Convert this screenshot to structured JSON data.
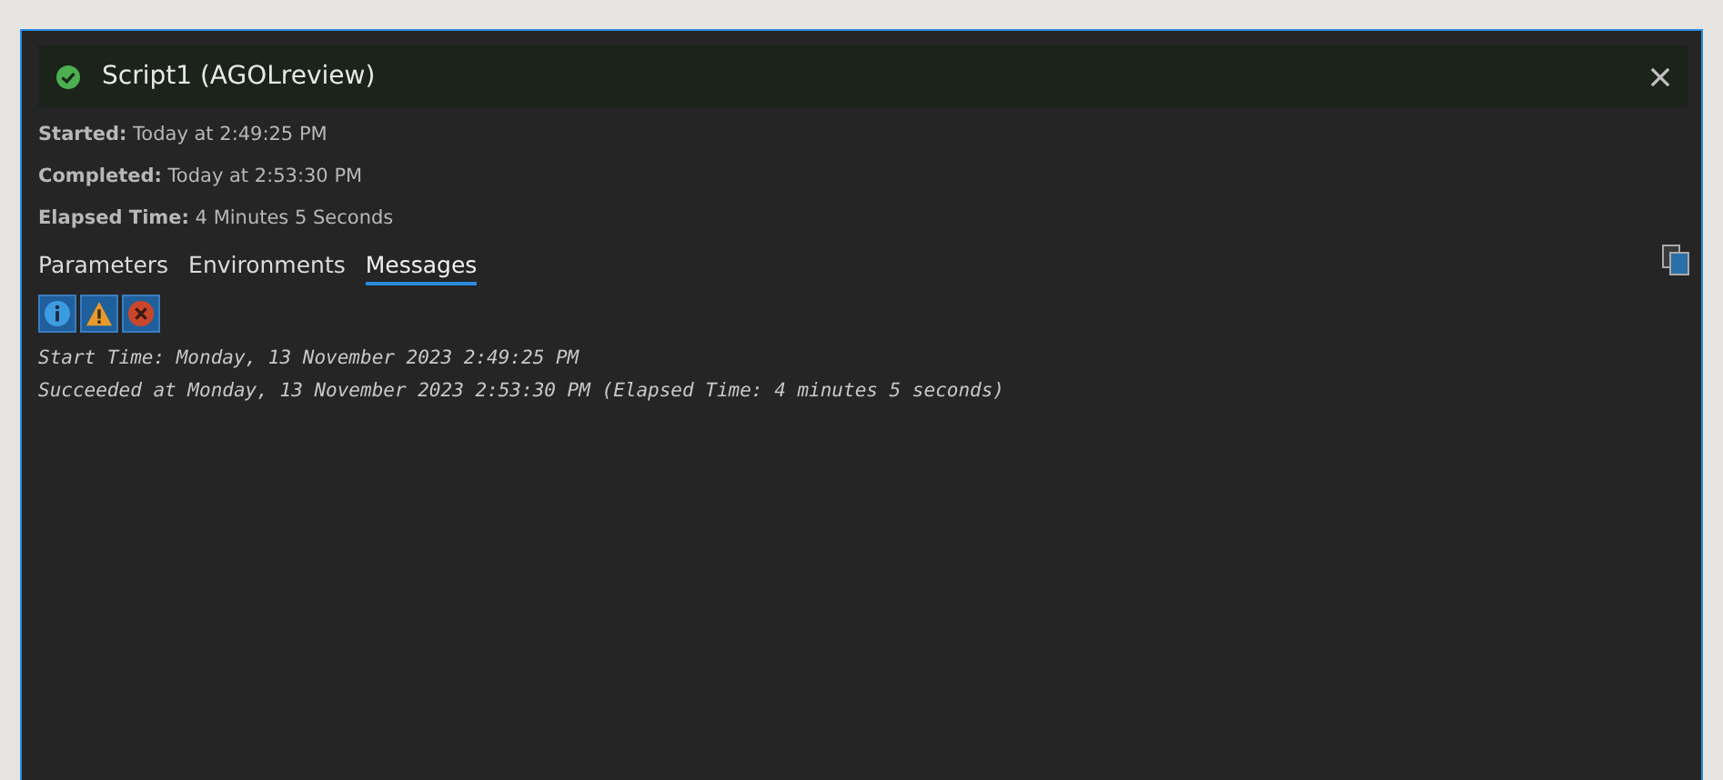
{
  "window": {
    "title": "Script1 (AGOLreview)",
    "succeeded": true
  },
  "details": [
    {
      "label": "Started:",
      "value": "Today at 2:49:25 PM"
    },
    {
      "label": "Completed:",
      "value": "Today at 2:53:30 PM"
    },
    {
      "label": "Elapsed Time:",
      "value": "4 Minutes 5 Seconds"
    }
  ],
  "tabs": [
    {
      "label": "Parameters",
      "selected": false
    },
    {
      "label": "Environments",
      "selected": false
    },
    {
      "label": "Messages",
      "selected": true
    }
  ],
  "filters": [
    {
      "kind": "info",
      "selected": true
    },
    {
      "kind": "warning",
      "selected": true
    },
    {
      "kind": "error",
      "selected": true
    }
  ],
  "messages": [
    "Start Time: Monday, 13 November 2023 2:49:25 PM",
    "Succeeded at Monday, 13 November 2023 2:53:30 PM (Elapsed Time: 4 minutes 5 seconds)"
  ]
}
